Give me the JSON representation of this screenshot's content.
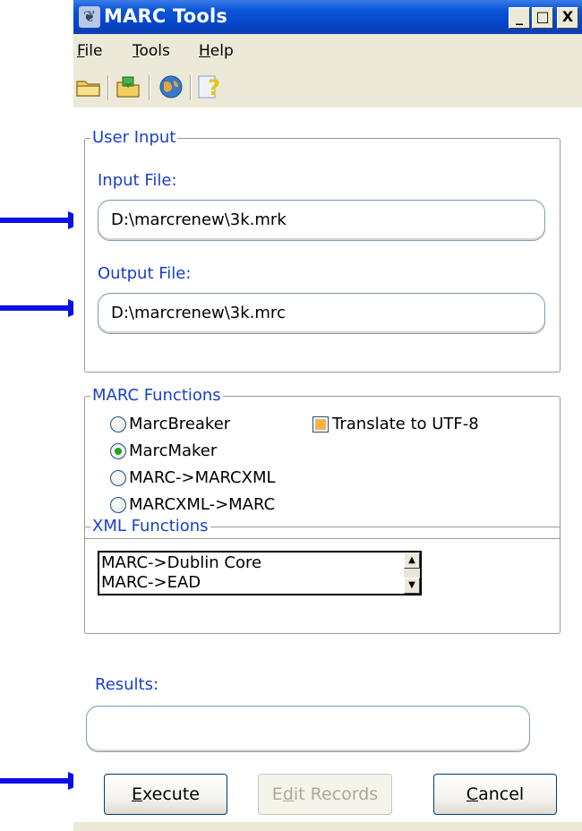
{
  "window": {
    "title": "MARC Tools",
    "controls": {
      "minimize": "_",
      "maximize": "□",
      "close": "X"
    }
  },
  "menu": [
    {
      "key": "F",
      "rest": "ile"
    },
    {
      "key": "T",
      "rest": "ools"
    },
    {
      "key": "H",
      "rest": "elp"
    }
  ],
  "toolbar": {
    "icons": [
      "open-folder-icon",
      "save-export-icon",
      "globe-icon",
      "help-icon"
    ]
  },
  "user_input": {
    "legend": "User Input",
    "input_label": "Input File:",
    "input_value": "D:\\marcrenew\\3k.mrk",
    "output_label": "Output File:",
    "output_value": "D:\\marcrenew\\3k.mrc"
  },
  "marc_functions": {
    "legend": "MARC Functions",
    "options": [
      {
        "label": "MarcBreaker",
        "checked": false
      },
      {
        "label": "MarcMaker",
        "checked": true
      },
      {
        "label": "MARC->MARCXML",
        "checked": false
      },
      {
        "label": "MARCXML->MARC",
        "checked": false
      }
    ],
    "translate_label": "Translate to UTF-8"
  },
  "xml_functions": {
    "legend": "XML Functions",
    "items": [
      "MARC->Dublin Core",
      "MARC->EAD"
    ]
  },
  "results": {
    "label": "Results:",
    "value": ""
  },
  "buttons": {
    "execute_key": "E",
    "execute_rest": "xecute",
    "edit_pre": "E",
    "edit_key": "d",
    "edit_rest": "it Records",
    "cancel_key": "C",
    "cancel_rest": "ancel"
  },
  "colors": {
    "label_blue": "#1a3fc9",
    "arrow_blue": "#0a10e6",
    "titlebar_blue": "#0a56d8",
    "window_bg": "#ECE9D8"
  }
}
